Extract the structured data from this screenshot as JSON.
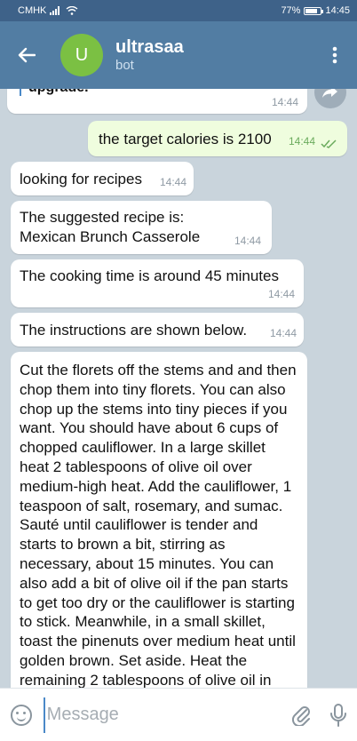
{
  "status_bar": {
    "carrier": "CMHK",
    "battery": "77%",
    "battery_level": 0.77,
    "time": "14:45"
  },
  "header": {
    "avatar_letter": "U",
    "title": "ultrasaa",
    "subtitle": "bot",
    "avatar_color": "#7bc043",
    "bar_color": "#527da3"
  },
  "messages": [
    {
      "text": "upgrade.",
      "time": "14:44",
      "direction": "in"
    },
    {
      "text": "the target calories is 2100",
      "time": "14:44",
      "direction": "out"
    },
    {
      "text": "looking for recipes",
      "time": "14:44",
      "direction": "in"
    },
    {
      "text": "The suggested recipe is: Mexican Brunch Casserole",
      "time": "14:44",
      "direction": "in"
    },
    {
      "text": "The cooking time is around 45 minutes",
      "time": "14:44",
      "direction": "in"
    },
    {
      "text": "The instructions are shown below.",
      "time": "14:44",
      "direction": "in"
    },
    {
      "text": "Cut the florets off the stems and and then chop them into tiny florets. You can also chop up the stems into tiny pieces if you want. You should have about 6 cups of chopped cauliflower. In a large skillet heat 2 tablespoons of olive oil over medium-high heat. Add the cauliflower, 1 teaspoon of salt, rosemary, and sumac. Sauté until cauliflower is tender and starts to brown a bit, stirring as necessary, about 15 minutes. You can also add a bit of olive oil if the pan starts to get too dry or the cauliflower is starting to stick. Meanwhile, in a small skillet, toast the pinenuts over medium heat until golden brown. Set aside. Heat the remaining 2 tablespoons of olive oil in",
      "direction": "in"
    }
  ],
  "input": {
    "placeholder": "Message"
  },
  "icons": {
    "back": "arrow-left-icon",
    "menu": "more-vertical-icon",
    "share": "share-arrow-icon",
    "emoji": "smiley-icon",
    "attach": "paperclip-icon",
    "mic": "microphone-icon",
    "read": "double-check-icon"
  }
}
